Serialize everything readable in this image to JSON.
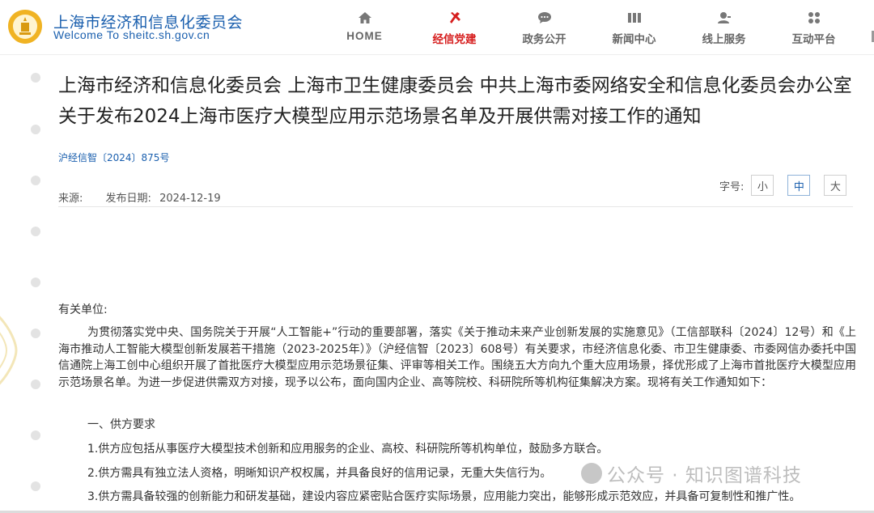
{
  "header": {
    "brand_cn": "上海市经济和信息化委员会",
    "brand_en": "Welcome To sheitc.sh.gov.cn",
    "nav": [
      {
        "label": "HOME",
        "icon": "home-icon"
      },
      {
        "label": "经信党建",
        "icon": "party-emblem-icon",
        "active": true
      },
      {
        "label": "政务公开",
        "icon": "chat-icon"
      },
      {
        "label": "新闻中心",
        "icon": "news-icon"
      },
      {
        "label": "线上服务",
        "icon": "user-service-icon"
      },
      {
        "label": "互动平台",
        "icon": "interaction-icon"
      }
    ]
  },
  "article": {
    "title": "上海市经济和信息化委员会 上海市卫生健康委员会 中共上海市委网络安全和信息化委员会办公室关于发布2024上海市医疗大模型应用示范场景名单及开展供需对接工作的通知",
    "doc_number": "沪经信智〔2024〕875号",
    "source_label": "来源:",
    "date_label": "发布日期:",
    "date_value": "2024-12-19",
    "font_size_label": "字号:",
    "font_sizes": [
      "小",
      "中",
      "大"
    ],
    "font_size_selected": "中",
    "salutation": "有关单位:",
    "paragraph1": "为贯彻落实党中央、国务院关于开展“人工智能+”行动的重要部署，落实《关于推动未来产业创新发展的实施意见》（工信部联科〔2024〕12号）和《上海市推动人工智能大模型创新发展若干措施（2023-2025年）》（沪经信智〔2023〕608号）有关要求，市经济信息化委、市卫生健康委、市委网信办委托中国信通院上海工创中心组织开展了首批医疗大模型应用示范场景征集、评审等相关工作。围绕五大方向九个重大应用场景，择优形成了上海市首批医疗大模型应用示范场景名单。为进一步促进供需双方对接，现予以公布，面向国内企业、高等院校、科研院所等机构征集解决方案。现将有关工作通知如下：",
    "section1_heading": "一、供方要求",
    "item1": "1.供方应包括从事医疗大模型技术创新和应用服务的企业、高校、科研院所等机构单位，鼓励多方联合。",
    "item2": "2.供方需具有独立法人资格，明晰知识产权权属，并具备良好的信用记录，无重大失信行为。",
    "item3": "3.供方需具备较强的创新能力和研发基础，建设内容应紧密贴合医疗实际场景，应用能力突出，能够形成示范效应，并具备可复制性和推广性。"
  },
  "watermark": {
    "text": "公众号 · 知识图谱科技"
  },
  "colors": {
    "brand_blue": "#1a5fae",
    "active_red": "#d61d1d"
  }
}
